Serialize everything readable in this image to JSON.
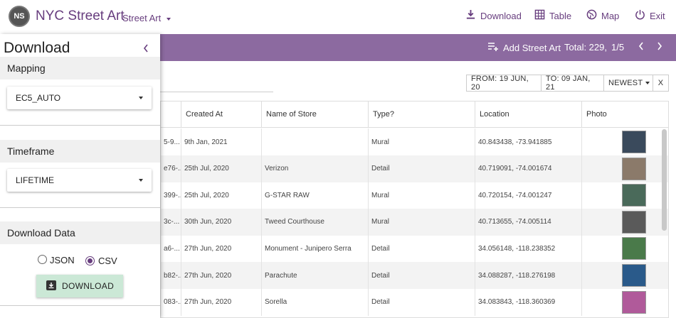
{
  "header": {
    "avatar_initials": "NS",
    "title": "NYC Street Art",
    "project": "Street Art",
    "nav": {
      "download": "Download",
      "table": "Table",
      "map": "Map",
      "exit": "Exit"
    }
  },
  "toolbar": {
    "add_label": "Add Street Art",
    "total": "Total: 229,",
    "page": "1/5"
  },
  "filters": {
    "from": "FROM: 19 JUN, 20",
    "to": "TO: 09 JAN, 21",
    "sort": "NEWEST",
    "clear": "X"
  },
  "table": {
    "headers": [
      "Created At",
      "Name of Store",
      "Type?",
      "Location",
      "Photo"
    ],
    "rows": [
      {
        "id": "5-9...",
        "created": "9th Jan, 2021",
        "name": "",
        "type": "Mural",
        "location": "40.843438, -73.941885",
        "photo": "#3a4a5c"
      },
      {
        "id": "e76-...",
        "created": "25th Jul, 2020",
        "name": "Verizon",
        "type": "Detail",
        "location": "40.719091, -74.001674",
        "photo": "#8b7a6a"
      },
      {
        "id": "399-...",
        "created": "25th Jul, 2020",
        "name": "G-STAR RAW",
        "type": "Mural",
        "location": "40.720154, -74.001247",
        "photo": "#4a6a5a"
      },
      {
        "id": "3c-...",
        "created": "30th Jun, 2020",
        "name": "Tweed Courthouse",
        "type": "Mural",
        "location": "40.713655, -74.005114",
        "photo": "#5a5a5a"
      },
      {
        "id": "a6-...",
        "created": "27th Jun, 2020",
        "name": "Monument - Junipero Serra",
        "type": "Detail",
        "location": "34.056148, -118.238352",
        "photo": "#4a7a4a"
      },
      {
        "id": "b82-...",
        "created": "27th Jun, 2020",
        "name": "Parachute",
        "type": "Detail",
        "location": "34.088287, -118.276198",
        "photo": "#2a5a8a"
      },
      {
        "id": "083-...",
        "created": "27th Jun, 2020",
        "name": "Sorella",
        "type": "Detail",
        "location": "34.083843, -118.360369",
        "photo": "#b05a9a"
      }
    ]
  },
  "panel": {
    "title": "Download",
    "mapping_label": "Mapping",
    "mapping_value": "EC5_AUTO",
    "timeframe_label": "Timeframe",
    "timeframe_value": "LIFETIME",
    "download_data_label": "Download Data",
    "format_json": "JSON",
    "format_csv": "CSV",
    "selected_format": "CSV",
    "download_button": "DOWNLOAD"
  },
  "colors": {
    "brand": "#673d7e",
    "toolbar": "#8c6aa0",
    "download_button": "#cbe8d6"
  }
}
